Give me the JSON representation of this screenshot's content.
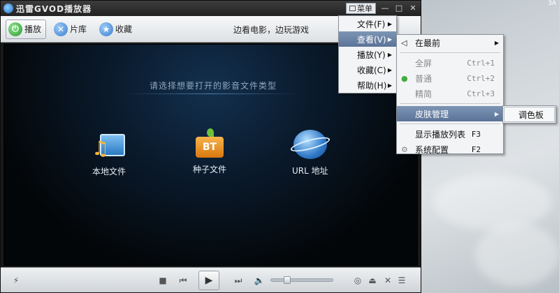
{
  "corner": "3A",
  "app": {
    "title": "迅雷GVOD播放器"
  },
  "titlebar": {
    "menu_label": "菜单",
    "min": "—",
    "max": "□",
    "close": "✕"
  },
  "toolbar": {
    "play_label": "播放",
    "library_label": "片库",
    "favorites_label": "收藏",
    "slogan": "边看电影，边玩游戏"
  },
  "screen": {
    "prompt": "请选择想要打开的影音文件类型",
    "options": [
      {
        "label": "本地文件"
      },
      {
        "label": "种子文件",
        "badge": "BT"
      },
      {
        "label": "URL 地址"
      }
    ]
  },
  "main_menu": {
    "items": [
      {
        "label": "文件(F)"
      },
      {
        "label": "查看(V)"
      },
      {
        "label": "播放(Y)"
      },
      {
        "label": "收藏(C)"
      },
      {
        "label": "帮助(H)"
      }
    ]
  },
  "view_menu": {
    "always_on_top": "在最前",
    "fullscreen": "全屏",
    "fullscreen_shortcut": "Ctrl+1",
    "normal": "普通",
    "normal_shortcut": "Ctrl+2",
    "compact": "精简",
    "compact_shortcut": "Ctrl+3",
    "skin": "皮肤管理",
    "playlist": "显示播放列表",
    "playlist_shortcut": "F3",
    "settings": "系统配置",
    "settings_shortcut": "F2"
  },
  "skin_menu": {
    "palette": "调色板"
  },
  "volume": {
    "level": 0.25
  }
}
